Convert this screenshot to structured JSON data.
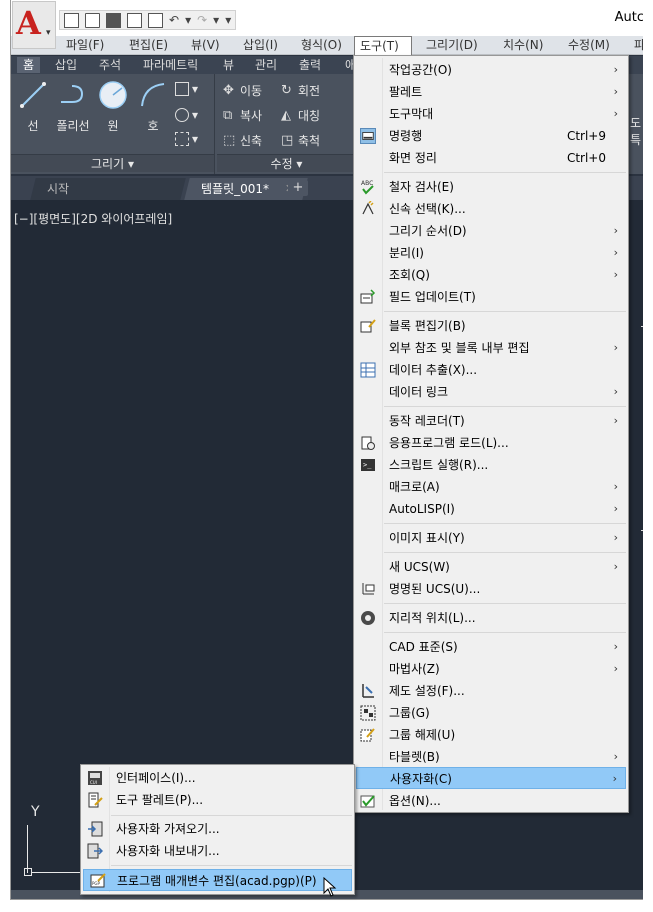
{
  "title": {
    "app_name": "Autc"
  },
  "qat": {
    "undo": "↶",
    "redo": "↷"
  },
  "menubar": {
    "items": [
      {
        "label": "파일(F)"
      },
      {
        "label": "편집(E)"
      },
      {
        "label": "뷰(V)"
      },
      {
        "label": "삽입(I)"
      },
      {
        "label": "형식(O)"
      },
      {
        "label": "도구(T)"
      },
      {
        "label": "그리기(D)"
      },
      {
        "label": "치수(N)"
      },
      {
        "label": "수정(M)"
      },
      {
        "label": "파"
      }
    ]
  },
  "ribbon": {
    "tabs": [
      {
        "label": "홈"
      },
      {
        "label": "삽입"
      },
      {
        "label": "주석"
      },
      {
        "label": "파라메트릭"
      },
      {
        "label": "뷰"
      },
      {
        "label": "관리"
      },
      {
        "label": "출력"
      },
      {
        "label": "애"
      }
    ],
    "draw_panel": {
      "label": "그리기 ▾",
      "tools": [
        {
          "label": "선"
        },
        {
          "label": "폴리선"
        },
        {
          "label": "원"
        },
        {
          "label": "호"
        }
      ]
    },
    "modify_panel": {
      "label": "수정 ▾",
      "tools": [
        {
          "label": "이동"
        },
        {
          "label": "회전"
        },
        {
          "label": "복사"
        },
        {
          "label": "대칭"
        },
        {
          "label": "신축"
        },
        {
          "label": "축척"
        }
      ]
    },
    "right_edge": {
      "label": "도\n특"
    }
  },
  "filetabs": {
    "items": [
      {
        "label": "시작"
      },
      {
        "label": "템플릿_001*"
      }
    ],
    "close": "✕",
    "add": "+"
  },
  "viewport": {
    "label": "[−][평면도][2D 와이어프레임]",
    "ucs_y": "Y"
  },
  "tools_menu": {
    "items": [
      {
        "label": "작업공간(O)",
        "shortcut": "",
        "submenu": true,
        "icon": ""
      },
      {
        "label": "팔레트",
        "shortcut": "",
        "submenu": true,
        "icon": ""
      },
      {
        "label": "도구막대",
        "shortcut": "",
        "submenu": true,
        "icon": ""
      },
      {
        "label": "명령행",
        "shortcut": "Ctrl+9",
        "submenu": false,
        "icon": "command-line-icon"
      },
      {
        "label": "화면 정리",
        "shortcut": "Ctrl+0",
        "submenu": false,
        "icon": ""
      },
      {
        "label": "철자 검사(E)",
        "shortcut": "",
        "submenu": false,
        "icon": "spell-check-icon"
      },
      {
        "label": "신속 선택(K)...",
        "shortcut": "",
        "submenu": false,
        "icon": "quick-select-icon"
      },
      {
        "label": "그리기 순서(D)",
        "shortcut": "",
        "submenu": true,
        "icon": ""
      },
      {
        "label": "분리(I)",
        "shortcut": "",
        "submenu": true,
        "icon": ""
      },
      {
        "label": "조회(Q)",
        "shortcut": "",
        "submenu": true,
        "icon": ""
      },
      {
        "label": "필드 업데이트(T)",
        "shortcut": "",
        "submenu": false,
        "icon": "update-field-icon"
      },
      {
        "label": "블록 편집기(B)",
        "shortcut": "",
        "submenu": false,
        "icon": "block-editor-icon"
      },
      {
        "label": "외부 참조 및 블록 내부 편집",
        "shortcut": "",
        "submenu": true,
        "icon": ""
      },
      {
        "label": "데이터 추출(X)...",
        "shortcut": "",
        "submenu": false,
        "icon": "data-extraction-icon"
      },
      {
        "label": "데이터 링크",
        "shortcut": "",
        "submenu": true,
        "icon": ""
      },
      {
        "label": "동작 레코더(T)",
        "shortcut": "",
        "submenu": true,
        "icon": ""
      },
      {
        "label": "응용프로그램 로드(L)...",
        "shortcut": "",
        "submenu": false,
        "icon": "load-application-icon"
      },
      {
        "label": "스크립트 실행(R)...",
        "shortcut": "",
        "submenu": false,
        "icon": "run-script-icon"
      },
      {
        "label": "매크로(A)",
        "shortcut": "",
        "submenu": true,
        "icon": ""
      },
      {
        "label": "AutoLISP(I)",
        "shortcut": "",
        "submenu": true,
        "icon": ""
      },
      {
        "label": "이미지 표시(Y)",
        "shortcut": "",
        "submenu": true,
        "icon": ""
      },
      {
        "label": "새 UCS(W)",
        "shortcut": "",
        "submenu": true,
        "icon": ""
      },
      {
        "label": "명명된 UCS(U)...",
        "shortcut": "",
        "submenu": false,
        "icon": "named-ucs-icon"
      },
      {
        "label": "지리적 위치(L)...",
        "shortcut": "",
        "submenu": false,
        "icon": "geographic-location-icon"
      },
      {
        "label": "CAD 표준(S)",
        "shortcut": "",
        "submenu": true,
        "icon": ""
      },
      {
        "label": "마법사(Z)",
        "shortcut": "",
        "submenu": true,
        "icon": ""
      },
      {
        "label": "제도 설정(F)...",
        "shortcut": "",
        "submenu": false,
        "icon": "drafting-settings-icon"
      },
      {
        "label": "그룹(G)",
        "shortcut": "",
        "submenu": false,
        "icon": "group-icon"
      },
      {
        "label": "그룹 해제(U)",
        "shortcut": "",
        "submenu": false,
        "icon": "ungroup-icon"
      },
      {
        "label": "타블렛(B)",
        "shortcut": "",
        "submenu": true,
        "icon": ""
      },
      {
        "label": "사용자화(C)",
        "shortcut": "",
        "submenu": true,
        "icon": ""
      },
      {
        "label": "옵션(N)...",
        "shortcut": "",
        "submenu": false,
        "icon": "options-icon"
      }
    ]
  },
  "customize_menu": {
    "items": [
      {
        "label": "인터페이스(I)...",
        "icon": "interface-icon"
      },
      {
        "label": "도구 팔레트(P)...",
        "icon": "tool-palette-icon"
      },
      {
        "label": "사용자화 가져오기...",
        "icon": "import-customization-icon"
      },
      {
        "label": "사용자화 내보내기...",
        "icon": "export-customization-icon"
      },
      {
        "label": "프로그램 매개변수 편집(acad.pgp)(P)",
        "icon": "edit-pgp-icon"
      }
    ]
  },
  "colors": {
    "accent": "#91c9f7",
    "logo": "#c8231f",
    "canvas": "#222a36",
    "ribbon": "#4a525e"
  }
}
